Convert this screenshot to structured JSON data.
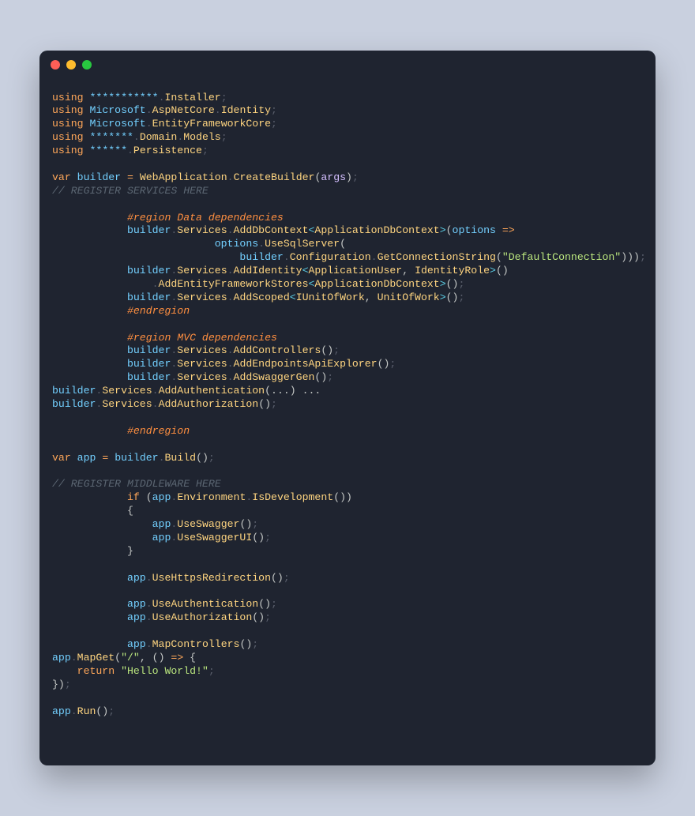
{
  "window": {
    "dots": [
      "close",
      "minimize",
      "zoom"
    ]
  },
  "code": {
    "using1_kw": "using",
    "using1_ns1": "***********",
    "using1_dot": ".",
    "using1_ns2": "Installer",
    "semi": ";",
    "using2_kw": "using",
    "using2_ns1": "Microsoft",
    "using2_ns2": "AspNetCore",
    "using2_ns3": "Identity",
    "using3_kw": "using",
    "using3_ns1": "Microsoft",
    "using3_ns2": "EntityFrameworkCore",
    "using4_kw": "using",
    "using4_ns1": "*******",
    "using4_ns2": "Domain",
    "using4_ns3": "Models",
    "using5_kw": "using",
    "using5_ns1": "******",
    "using5_ns2": "Persistence",
    "var": "var",
    "builder": "builder",
    "eq": "=",
    "WebApplication": "WebApplication",
    "CreateBuilder": "CreateBuilder",
    "args": "args",
    "cmt_services": "// REGISTER SERVICES HERE",
    "region_data": "#region Data dependencies",
    "Services": "Services",
    "AddDbContext": "AddDbContext",
    "ApplicationDbContext": "ApplicationDbContext",
    "options": "options",
    "arrow": "=>",
    "UseSqlServer": "UseSqlServer",
    "Configuration": "Configuration",
    "GetConnectionString": "GetConnectionString",
    "DefaultConnection": "\"DefaultConnection\"",
    "AddIdentity": "AddIdentity",
    "ApplicationUser": "ApplicationUser",
    "IdentityRole": "IdentityRole",
    "AddEntityFrameworkStores": "AddEntityFrameworkStores",
    "AddScoped": "AddScoped",
    "IUnitOfWork": "IUnitOfWork",
    "UnitOfWork": "UnitOfWork",
    "endregion": "#endregion",
    "region_mvc": "#region MVC dependencies",
    "AddControllers": "AddControllers",
    "AddEndpointsApiExplorer": "AddEndpointsApiExplorer",
    "AddSwaggerGen": "AddSwaggerGen",
    "AddAuthentication": "AddAuthentication",
    "dots3": "...",
    "AddAuthorization": "AddAuthorization",
    "app": "app",
    "Build": "Build",
    "cmt_middleware": "// REGISTER MIDDLEWARE HERE",
    "if": "if",
    "Environment": "Environment",
    "IsDevelopment": "IsDevelopment",
    "braceL": "{",
    "braceR": "}",
    "UseSwagger": "UseSwagger",
    "UseSwaggerUI": "UseSwaggerUI",
    "UseHttpsRedirection": "UseHttpsRedirection",
    "UseAuthentication": "UseAuthentication",
    "UseAuthorization": "UseAuthorization",
    "MapControllers": "MapControllers",
    "MapGet": "MapGet",
    "root": "\"/\"",
    "return": "return",
    "hello": "\"Hello World!\"",
    "Run": "Run",
    "comma": ", "
  }
}
